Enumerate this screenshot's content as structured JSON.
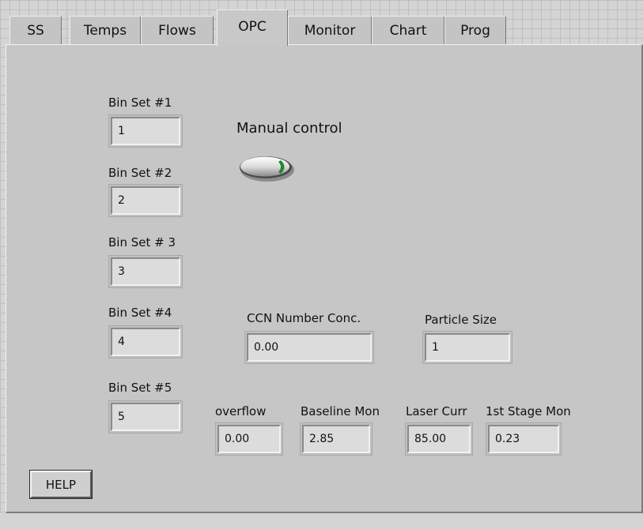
{
  "tabs": [
    {
      "label": "SS"
    },
    {
      "label": "Temps"
    },
    {
      "label": "Flows"
    },
    {
      "label": "OPC"
    },
    {
      "label": "Monitor"
    },
    {
      "label": "Chart"
    },
    {
      "label": "Prog"
    }
  ],
  "active_tab": "OPC",
  "bins": [
    {
      "label": "Bin Set #1",
      "value": "1"
    },
    {
      "label": "Bin Set #2",
      "value": "2"
    },
    {
      "label": "Bin Set # 3",
      "value": "3"
    },
    {
      "label": "Bin Set #4",
      "value": "4"
    },
    {
      "label": "Bin Set #5",
      "value": "5"
    }
  ],
  "manual_control": {
    "label": "Manual control",
    "state": "off"
  },
  "ccn": {
    "label": "CCN Number Conc.",
    "value": "0.00"
  },
  "particle_size": {
    "label": "Particle Size",
    "value": "1"
  },
  "overflow": {
    "label": "overflow",
    "value": "0.00"
  },
  "baseline_mon": {
    "label": "Baseline Mon",
    "value": "2.85"
  },
  "laser_curr": {
    "label": "Laser Curr",
    "value": "85.00"
  },
  "stage_mon": {
    "label": "1st Stage Mon",
    "value": "0.23"
  },
  "help": {
    "label": "HELP"
  },
  "colors": {
    "panel": "#c6c6c6",
    "field": "#dcdcdc",
    "led": "#1e8a2a"
  }
}
